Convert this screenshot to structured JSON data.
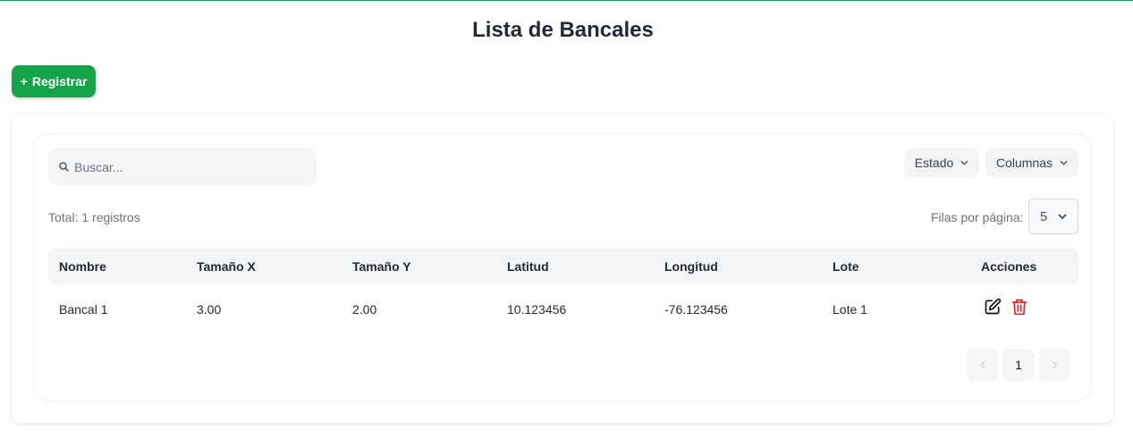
{
  "page": {
    "title": "Lista de Bancales"
  },
  "toolbar": {
    "register_label": "Registrar",
    "register_prefix": "+"
  },
  "search": {
    "placeholder": "Buscar...",
    "value": ""
  },
  "filters": {
    "estado_label": "Estado",
    "columnas_label": "Columnas"
  },
  "summary": {
    "total_text": "Total: 1 registros"
  },
  "rows_per_page": {
    "label": "Filas por página:",
    "value": "5"
  },
  "table": {
    "headers": [
      "Nombre",
      "Tamaño X",
      "Tamaño Y",
      "Latitud",
      "Longitud",
      "Lote",
      "Acciones"
    ],
    "rows": [
      {
        "nombre": "Bancal 1",
        "tamano_x": "3.00",
        "tamano_y": "2.00",
        "latitud": "10.123456",
        "longitud": "-76.123456",
        "lote": "Lote 1"
      }
    ]
  },
  "pagination": {
    "current_page": "1",
    "prev_icon": "chevron-left-icon",
    "next_icon": "chevron-right-icon"
  },
  "colors": {
    "accent": "#16a34a",
    "delete": "#dc2626",
    "edit": "#111111"
  }
}
